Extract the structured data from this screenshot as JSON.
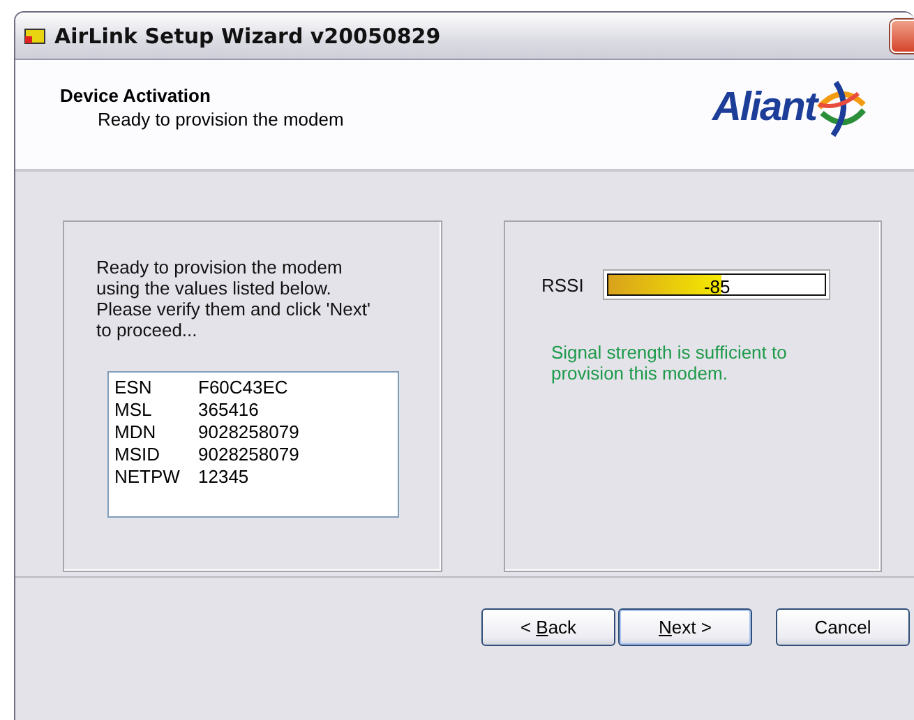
{
  "window": {
    "title": "AirLink Setup Wizard v20050829"
  },
  "header": {
    "title": "Device Activation",
    "subtitle": "Ready to provision the modem",
    "logo_text": "Aliant"
  },
  "left_panel": {
    "message": "Ready to provision the modem using the values listed below. Please verify them and click 'Next' to proceed...",
    "values": [
      {
        "key": "ESN",
        "value": "F60C43EC"
      },
      {
        "key": "MSL",
        "value": "365416"
      },
      {
        "key": "MDN",
        "value": "9028258079"
      },
      {
        "key": "MSID",
        "value": "9028258079"
      },
      {
        "key": "NETPW",
        "value": "12345"
      }
    ]
  },
  "right_panel": {
    "label": "RSSI",
    "meter": {
      "level": 0.52,
      "reading": "-85"
    },
    "status": "Signal strength is sufficient to provision this modem."
  },
  "buttons": [
    {
      "before": "< ",
      "accel": "B",
      "after": "ack"
    },
    {
      "accel": "N",
      "after": "ext >"
    },
    {
      "after": "Cancel"
    }
  ]
}
